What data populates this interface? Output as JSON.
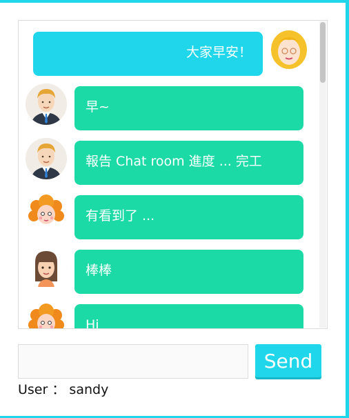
{
  "chat": {
    "messages": [
      {
        "sender": "self",
        "avatar": "blonde-woman-avatar",
        "text": "大家早安！"
      },
      {
        "sender": "other",
        "avatar": "businessman-avatar",
        "text": "早~"
      },
      {
        "sender": "other",
        "avatar": "businessman-avatar",
        "text": "報告 Chat room 進度 ... 完工"
      },
      {
        "sender": "other",
        "avatar": "red-haired-girl-avatar",
        "text": "有看到了 ..."
      },
      {
        "sender": "other",
        "avatar": "brown-haired-girl-avatar",
        "text": "棒棒"
      },
      {
        "sender": "other",
        "avatar": "red-haired-girl-avatar",
        "text": "Hi"
      }
    ]
  },
  "composer": {
    "input_value": "",
    "send_label": "Send"
  },
  "user": {
    "label": "User",
    "separator": "：",
    "name": "sandy"
  },
  "colors": {
    "accent": "#1fd6ea",
    "bubble_other": "#1bdaa6",
    "border": "#dcdcdc"
  }
}
